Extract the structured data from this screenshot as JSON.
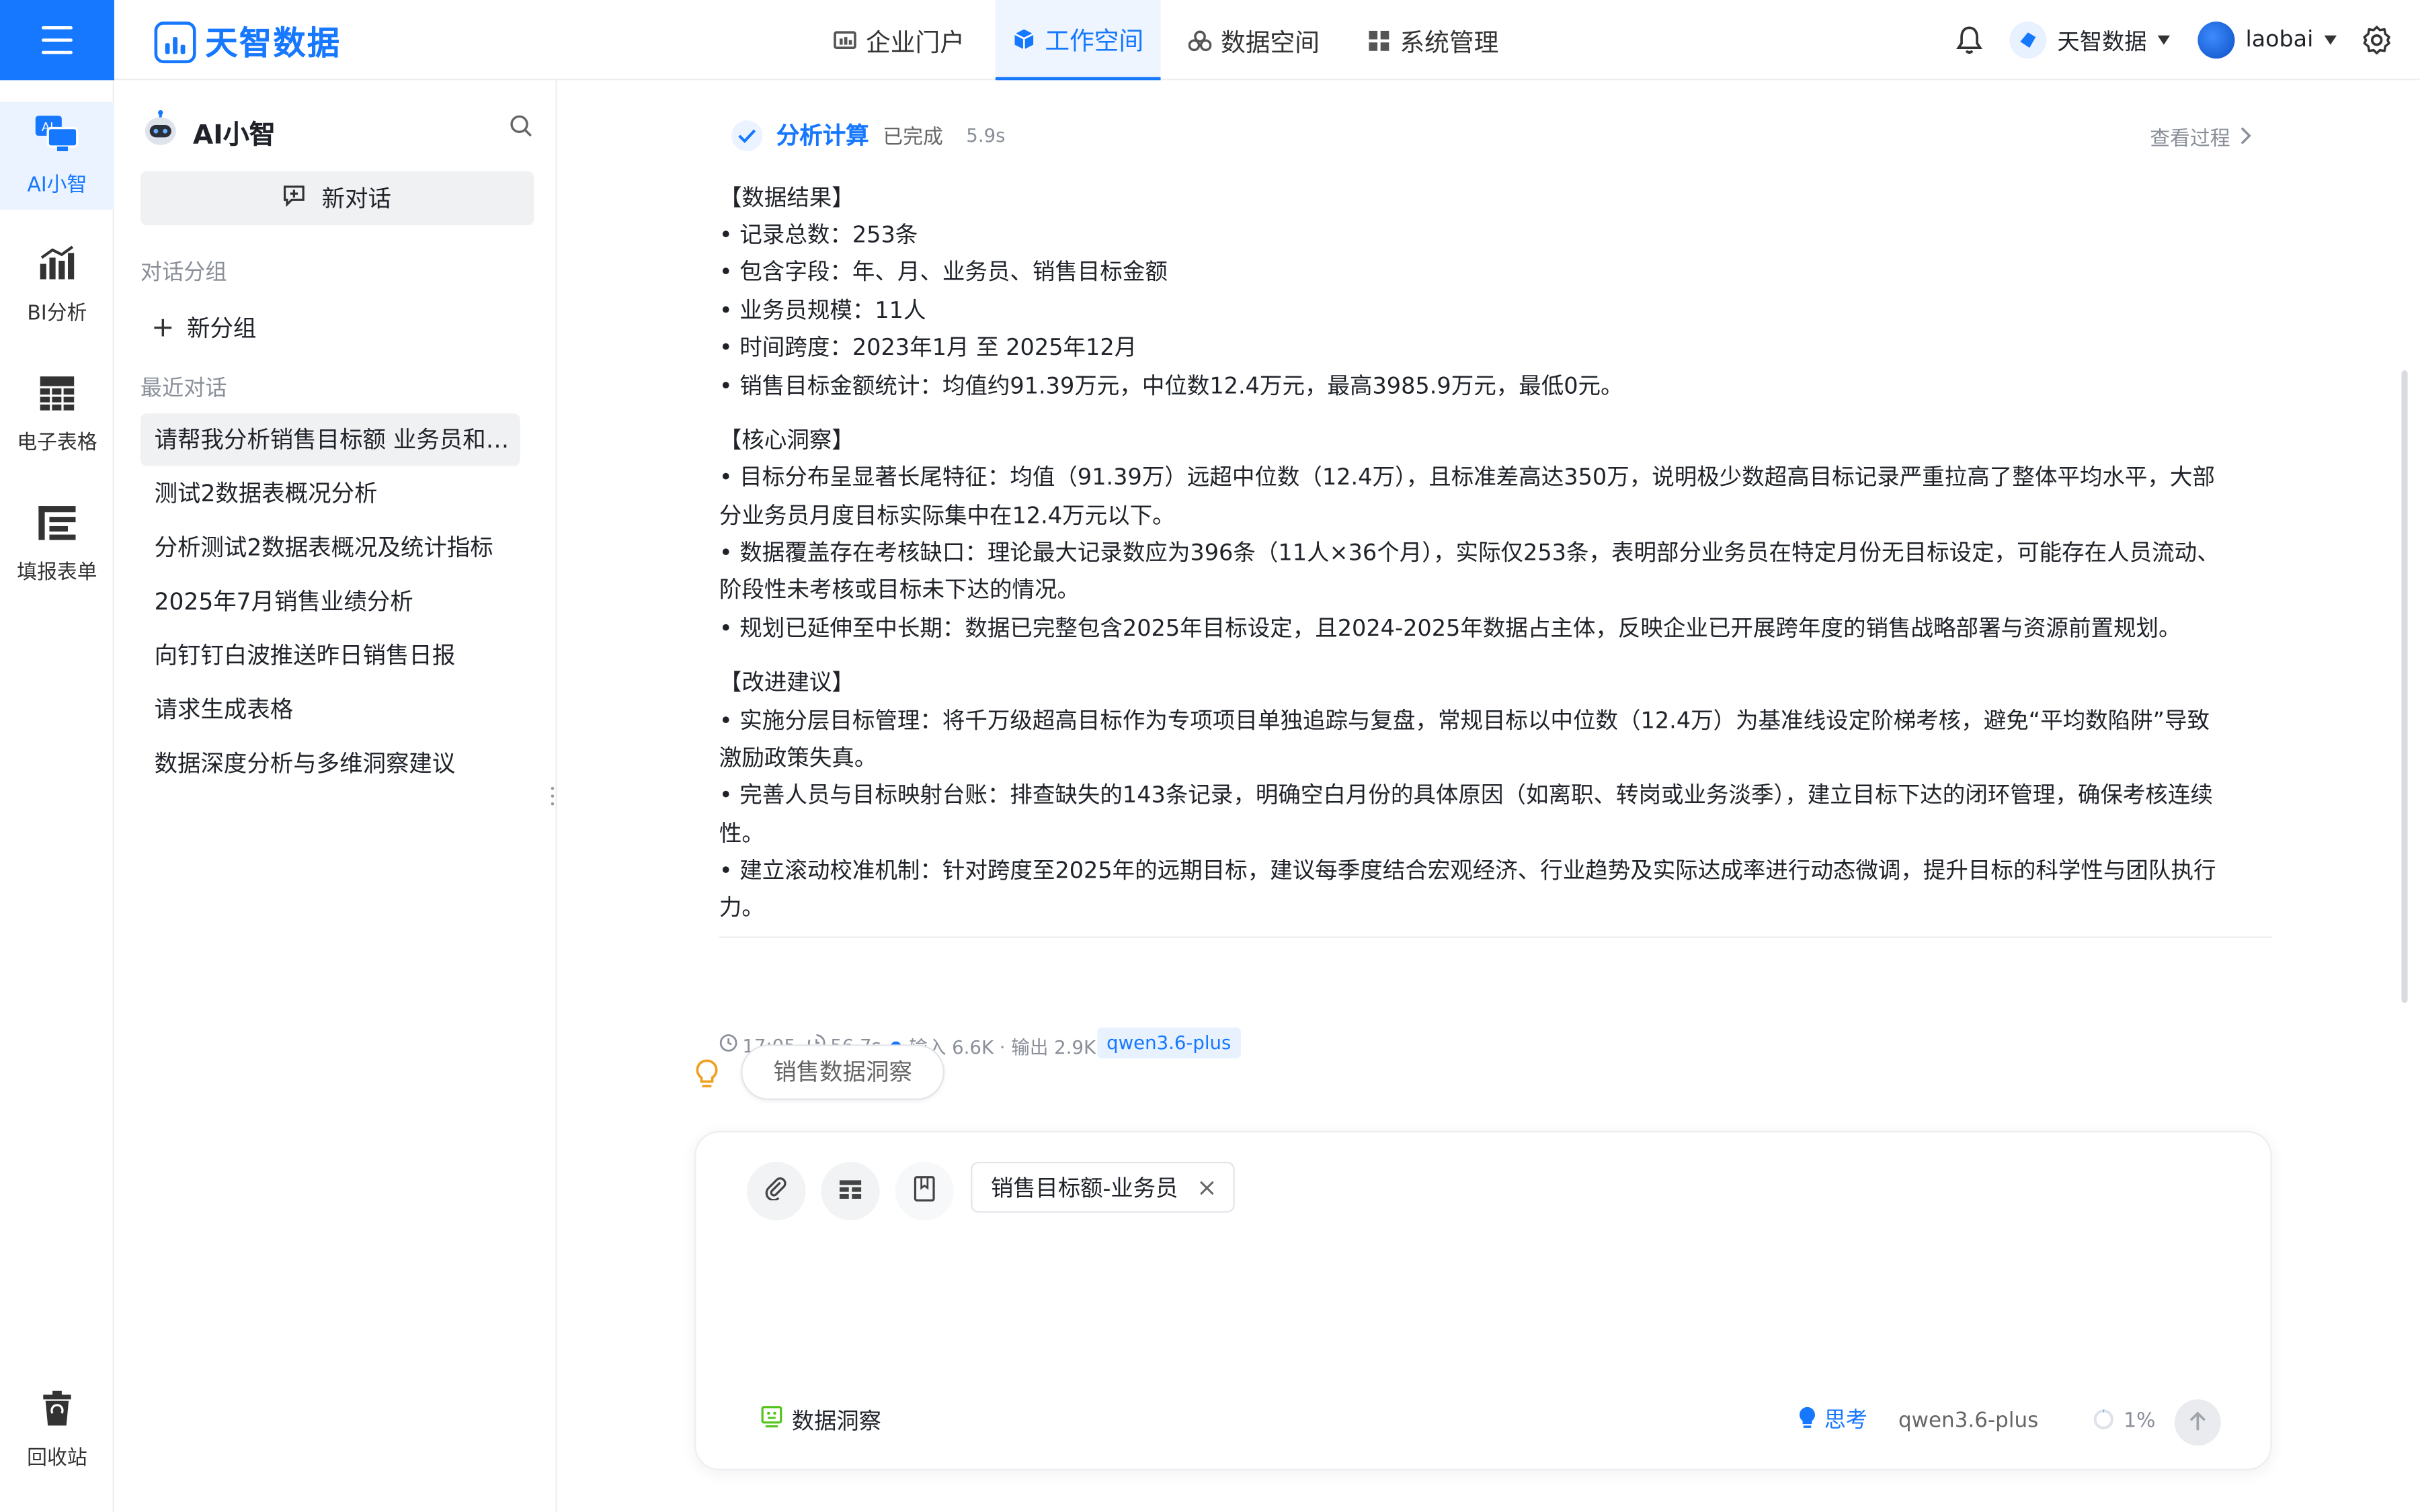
{
  "header": {
    "logo_text": "天智数据",
    "nav": [
      {
        "label": "企业门户",
        "icon": "portal-icon"
      },
      {
        "label": "工作空间",
        "icon": "cube-icon",
        "active": true
      },
      {
        "label": "数据空间",
        "icon": "data-space-icon"
      },
      {
        "label": "系统管理",
        "icon": "grid-icon"
      }
    ],
    "org_name": "天智数据",
    "username": "laobai"
  },
  "rail": {
    "items": [
      {
        "label": "AI小智",
        "icon": "ai-icon",
        "active": true
      },
      {
        "label": "BI分析",
        "icon": "bar-chart-icon"
      },
      {
        "label": "电子表格",
        "icon": "table-icon"
      },
      {
        "label": "填报表单",
        "icon": "form-icon"
      }
    ],
    "trash_label": "回收站"
  },
  "sidebar": {
    "title": "AI小智",
    "new_chat": "新对话",
    "groups_label": "对话分组",
    "new_group": "新分组",
    "recent_label": "最近对话",
    "conversations": [
      "请帮我分析销售目标额 业务员和月度",
      "测试2数据表概况分析",
      "分析测试2数据表概况及统计指标",
      "2025年7月销售业绩分析",
      "向钉钉白波推送昨日销售日报",
      "请求生成表格",
      "数据深度分析与多维洞察建议"
    ]
  },
  "analysis": {
    "title": "分析计算",
    "status": "已完成",
    "duration": "5.9s",
    "view_process": "查看过程"
  },
  "message": {
    "lines": [
      "【数据结果】",
      "• 记录总数：253条",
      "• 包含字段：年、月、业务员、销售目标金额",
      "• 业务员规模：11人",
      "• 时间跨度：2023年1月 至 2025年12月",
      "• 销售目标金额统计：均值约91.39万元，中位数12.4万元，最高3985.9万元，最低0元。",
      "【核心洞察】",
      "• 目标分布呈显著长尾特征：均值（91.39万）远超中位数（12.4万），且标准差高达350万，说明极少数超高目标记录严重拉高了整体平均水平，大部",
      "分业务员月度目标实际集中在12.4万元以下。",
      "• 数据覆盖存在考核缺口：理论最大记录数应为396条（11人×36个月），实际仅253条，表明部分业务员在特定月份无目标设定，可能存在人员流动、",
      "阶段性未考核或目标未下达的情况。",
      "• 规划已延伸至中长期：数据已完整包含2025年目标设定，且2024-2025年数据占主体，反映企业已开展跨年度的销售战略部署与资源前置规划。",
      "【改进建议】",
      "• 实施分层目标管理：将千万级超高目标作为专项项目单独追踪与复盘，常规目标以中位数（12.4万）为基准线设定阶梯考核，避免“平均数陷阱”导致",
      "激励政策失真。",
      "• 完善人员与目标映射台账：排查缺失的143条记录，明确空白月份的具体原因（如离职、转岗或业务淡季），建立目标下达的闭环管理，确保考核连续",
      "性。",
      "• 建立滚动校准机制：针对跨度至2025年的远期目标，建议每季度结合宏观经济、行业趋势及实际达成率进行动态微调，提升目标的科学性与团队执行",
      "力。"
    ],
    "time": "17:05",
    "elapsed": "56.7s",
    "tokens": "输入 6.6K · 输出 2.9K",
    "model_tag": "qwen3.6-plus"
  },
  "suggestion": "销售数据洞察",
  "composer": {
    "chip": "销售目标额-业务员",
    "mode": "数据洞察",
    "think": "思考",
    "model": "qwen3.6-plus",
    "context_percent": "1%"
  },
  "colors": {
    "accent": "#1677ff",
    "active_bg": "#eaf3ff",
    "tag_bg": "#e8f2ff"
  }
}
